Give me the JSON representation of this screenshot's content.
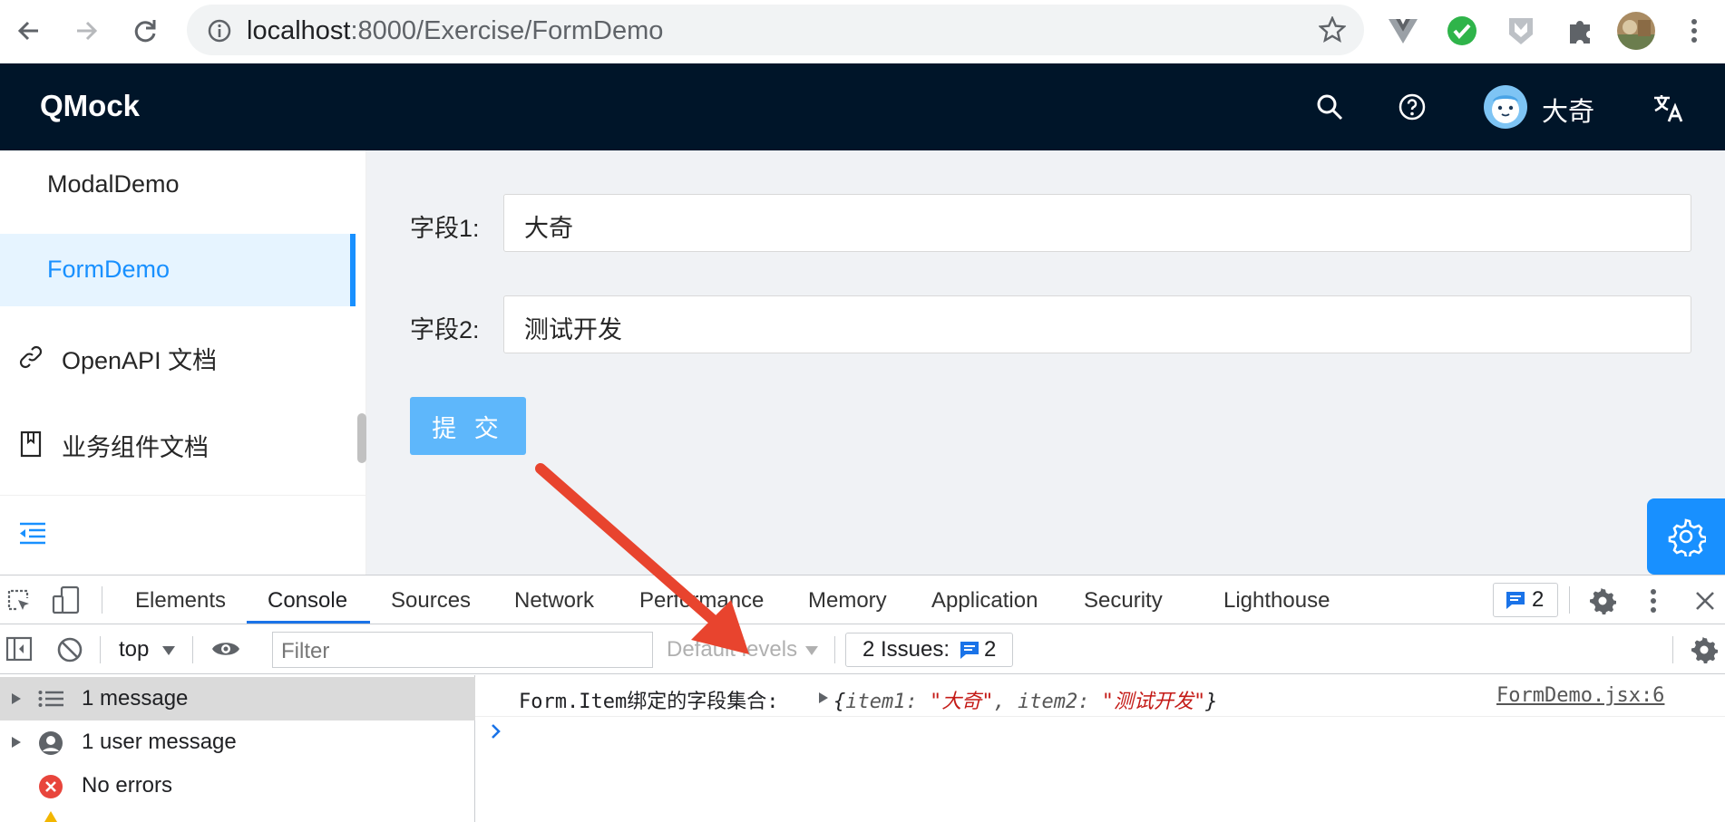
{
  "browser": {
    "url_host": "localhost",
    "url_path": ":8000/Exercise/FormDemo"
  },
  "app": {
    "brand": "QMock",
    "user_name": "大奇"
  },
  "sidebar": {
    "items": [
      {
        "label": "ModalDemo",
        "active": false
      },
      {
        "label": "FormDemo",
        "active": true
      },
      {
        "label": "OpenAPI 文档",
        "icon": "link-icon"
      },
      {
        "label": "业务组件文档",
        "icon": "book-icon"
      }
    ]
  },
  "form": {
    "field1": {
      "label": "字段1:",
      "value": "大奇"
    },
    "field2": {
      "label": "字段2:",
      "value": "测试开发"
    },
    "submit_label": "提 交"
  },
  "devtools": {
    "tabs": [
      "Elements",
      "Console",
      "Sources",
      "Network",
      "Performance",
      "Memory",
      "Application",
      "Security",
      "Lighthouse"
    ],
    "active_tab": "Console",
    "message_badge_count": "2",
    "context": "top",
    "filter_placeholder": "Filter",
    "levels_label": "Default levels",
    "issues_label": "2 Issues:",
    "issues_count": "2",
    "sidebar": {
      "messages": "1 message",
      "user_messages": "1 user message",
      "errors": "No errors"
    },
    "log": {
      "prefix": "Form.Item绑定的字段集合:",
      "open": "{",
      "key1": "item1",
      "val1": "\"大奇\"",
      "key2": "item2",
      "val2": "\"测试开发\"",
      "close": "}",
      "source": "FormDemo.jsx:6"
    }
  },
  "annotation": {
    "arrow_color": "#e8442e"
  }
}
